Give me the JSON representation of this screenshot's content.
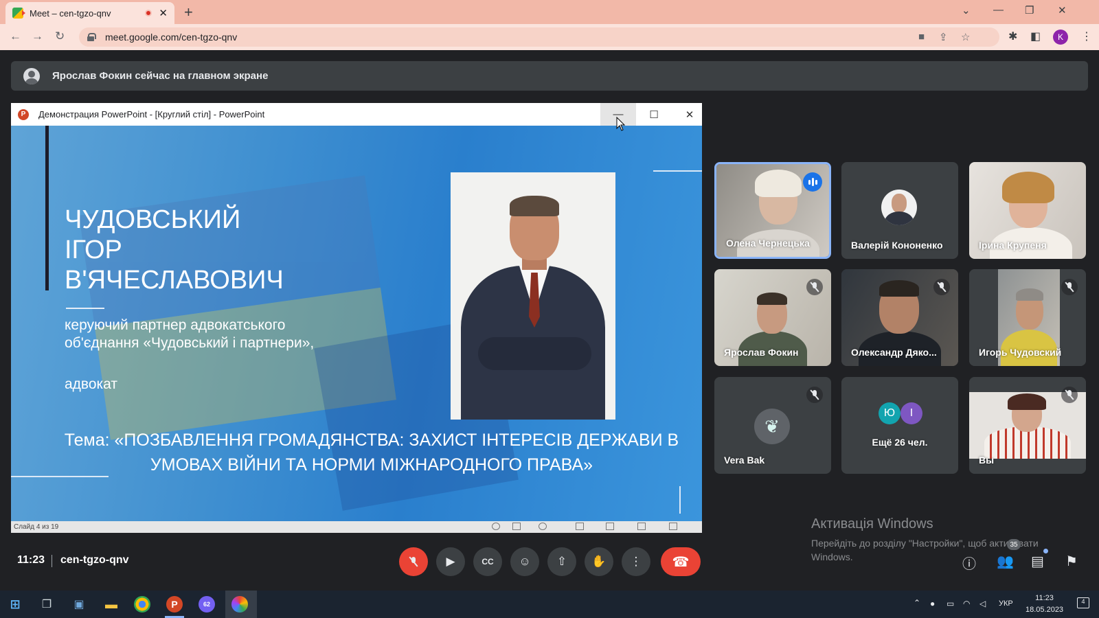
{
  "browser": {
    "tab_title": "Meet – cen-tgzo-qnv",
    "tab_close": "✕",
    "new_tab": "+",
    "url": "meet.google.com/cen-tgzo-qnv",
    "profile_initial": "K",
    "win_minimize": "—",
    "win_restore": "❐",
    "win_close": "✕",
    "tab_list": "⌄"
  },
  "banner": {
    "text": "Ярослав Фокин сейчас на главном экране"
  },
  "presentation": {
    "window_title": "Демонстрация PowerPoint - [Круглий стіл] - PowerPoint",
    "min": "—",
    "max": "☐",
    "close": "✕",
    "speaker_name_lines": [
      "ЧУДОВСЬКИЙ",
      "ІГОР",
      "В'ЯЧЕСЛАВОВИЧ"
    ],
    "role": "керуючий партнер адвокатського об'єднання «Чудовський і партнери»,",
    "role2": "адвокат",
    "topic_line1": "Тема: «ПОЗБАВЛЕННЯ ГРОМАДЯНСТВА: ЗАХИСТ ІНТЕРЕСІВ ДЕРЖАВИ В",
    "topic_line2": "УМОВАХ ВІЙНИ ТА НОРМИ МІЖНАРОДНОГО ПРАВА»",
    "status": "Слайд 4 из 19"
  },
  "participants": [
    {
      "name": "Олена Чернецька",
      "state": "speaking"
    },
    {
      "name": "Валерій Кононенко",
      "state": "unmuted"
    },
    {
      "name": "Ірина Крупеня",
      "state": "unmuted"
    },
    {
      "name": "Ярослав Фокин",
      "state": "muted"
    },
    {
      "name": "Олександр Дяко...",
      "state": "muted"
    },
    {
      "name": "Игорь Чудовский",
      "state": "muted"
    },
    {
      "name": "Vera Bak",
      "state": "muted"
    },
    {
      "name": "Ещё 26 чел.",
      "avatars": [
        "Ю",
        "І"
      ]
    },
    {
      "name": "Вы",
      "state": "muted"
    }
  ],
  "bottom": {
    "time": "11:23",
    "meeting_code": "cen-tgzo-qnv",
    "people_count": "35"
  },
  "activation": {
    "title": "Активація Windows",
    "body": "Перейдіть до розділу \"Настройки\", щоб активувати Windows."
  },
  "taskbar": {
    "lang": "УКР",
    "clock_time": "11:23",
    "clock_date": "18.05.2023",
    "notif_count": "4",
    "viber_badge": "62"
  },
  "colors": {
    "accent_blue": "#8ab4f8",
    "hangup_red": "#ea4335",
    "meet_bg": "#202124",
    "tab_bar": "#f2b8a8"
  }
}
